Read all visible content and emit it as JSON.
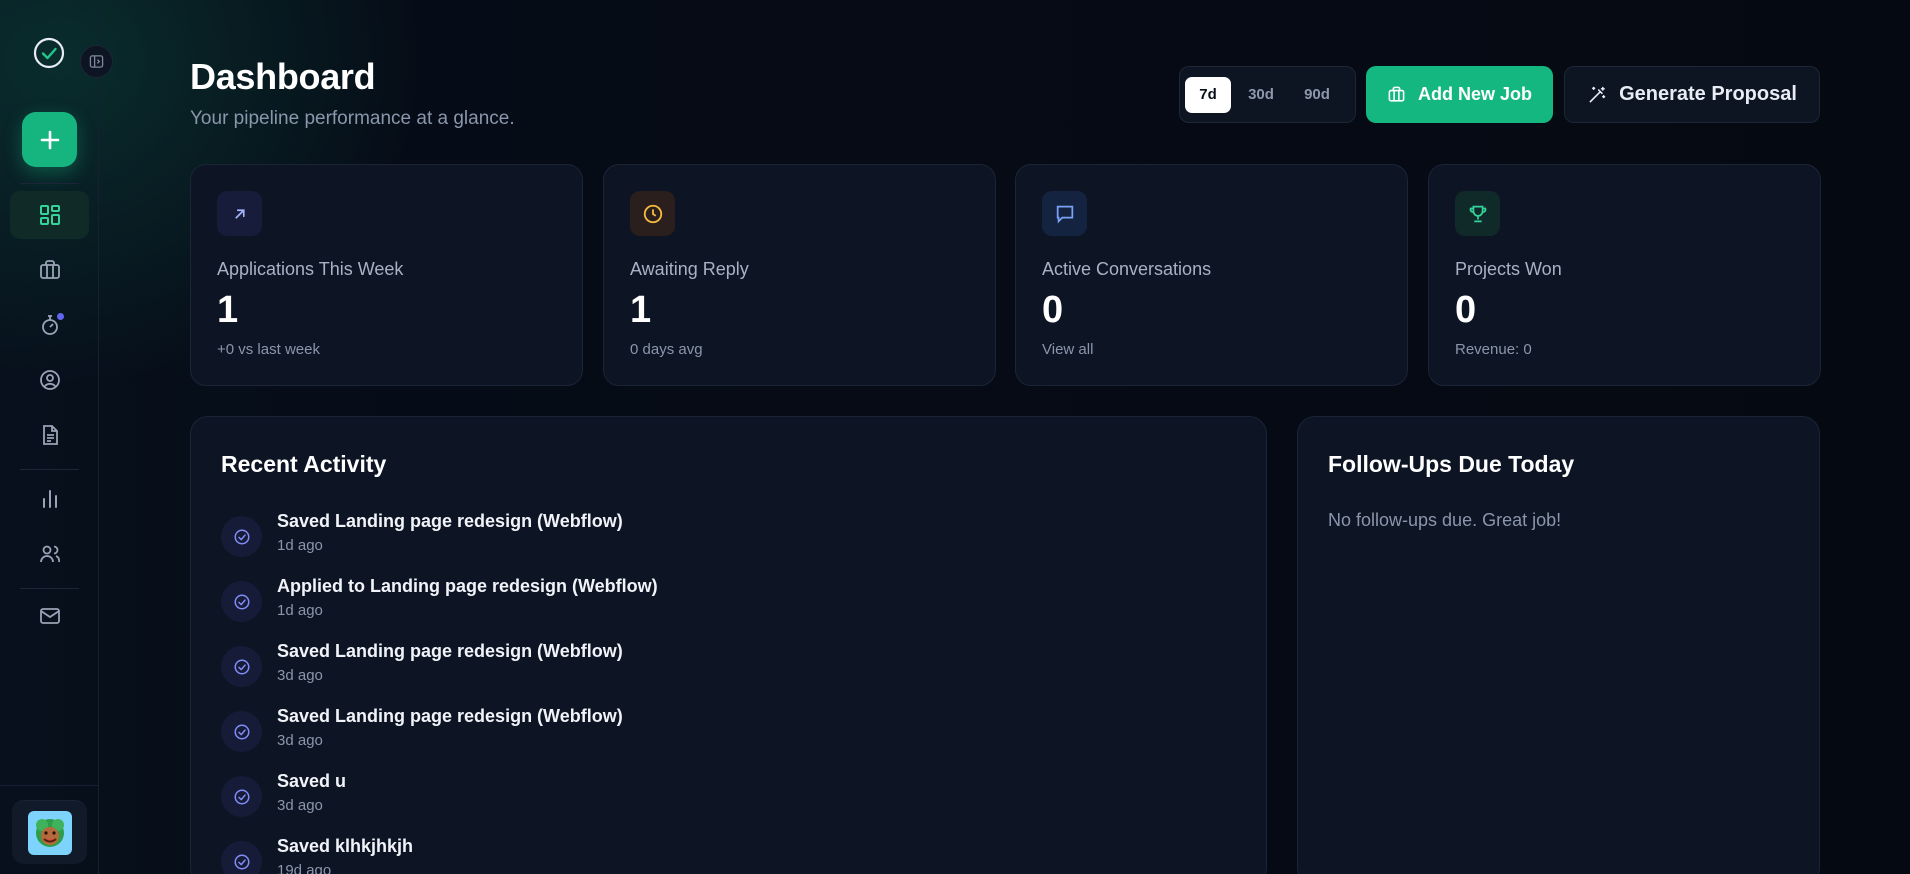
{
  "sidebar": {
    "items": [
      {
        "icon": "dashboard-grid-icon",
        "active": true
      },
      {
        "icon": "briefcase-icon",
        "active": false
      },
      {
        "icon": "stopwatch-icon",
        "active": false,
        "badge": true
      },
      {
        "icon": "user-circle-icon",
        "active": false
      },
      {
        "icon": "document-icon",
        "active": false
      },
      {
        "icon": "bar-chart-icon",
        "active": false
      },
      {
        "icon": "users-icon",
        "active": false
      },
      {
        "icon": "mail-icon",
        "active": false
      }
    ]
  },
  "header": {
    "title": "Dashboard",
    "subtitle": "Your pipeline performance at a glance.",
    "ranges": [
      "7d",
      "30d",
      "90d"
    ],
    "selected_range": "7d",
    "add_job_label": "Add New Job",
    "proposal_label": "Generate Proposal"
  },
  "stats": [
    {
      "label": "Applications This Week",
      "value": "1",
      "sub": "+0 vs last week",
      "icon": "arrow-up-right-icon",
      "color": "#a5b4fc"
    },
    {
      "label": "Awaiting Reply",
      "value": "1",
      "sub": "0 days avg",
      "icon": "clock-icon",
      "color": "#f5b942"
    },
    {
      "label": "Active Conversations",
      "value": "0",
      "sub": "View all",
      "icon": "chat-bubble-icon",
      "color": "#7aa2f7"
    },
    {
      "label": "Projects Won",
      "value": "0",
      "sub": "Revenue: 0",
      "icon": "trophy-icon",
      "color": "#34d399"
    }
  ],
  "activity": {
    "title": "Recent Activity",
    "items": [
      {
        "title": "Saved Landing page redesign (Webflow)",
        "time": "1d ago"
      },
      {
        "title": "Applied to Landing page redesign (Webflow)",
        "time": "1d ago"
      },
      {
        "title": "Saved Landing page redesign (Webflow)",
        "time": "3d ago"
      },
      {
        "title": "Saved Landing page redesign (Webflow)",
        "time": "3d ago"
      },
      {
        "title": "Saved u",
        "time": "3d ago"
      },
      {
        "title": "Saved klhkjhkjh",
        "time": "19d ago"
      }
    ]
  },
  "followups": {
    "title": "Follow-Ups Due Today",
    "empty": "No follow-ups due. Great job!"
  },
  "colors": {
    "accent": "#14b77f",
    "background": "#050913",
    "card": "#0d1424"
  }
}
